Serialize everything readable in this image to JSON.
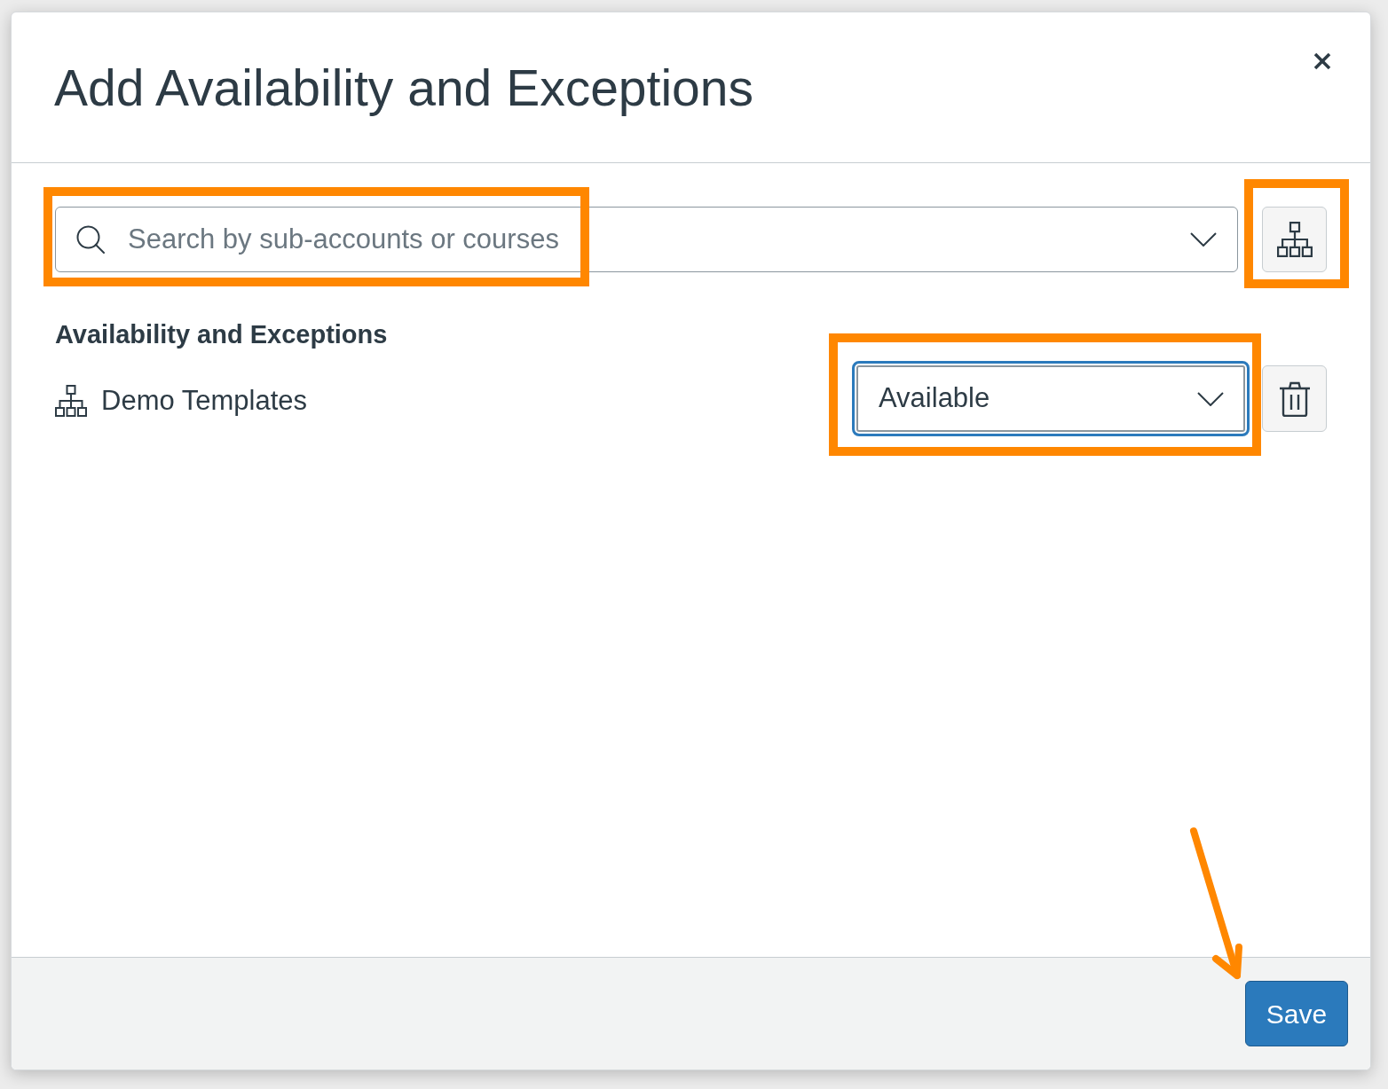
{
  "dialog": {
    "title": "Add Availability and Exceptions"
  },
  "search": {
    "placeholder": "Search by sub-accounts or courses",
    "highlighted": true
  },
  "tree_button": {
    "highlighted": true
  },
  "section": {
    "heading": "Availability and Exceptions",
    "items": [
      {
        "name": "Demo Templates",
        "status": "Available",
        "focused": true,
        "highlighted": true
      }
    ]
  },
  "footer": {
    "save": {
      "label": "Save",
      "pointed": true
    }
  }
}
